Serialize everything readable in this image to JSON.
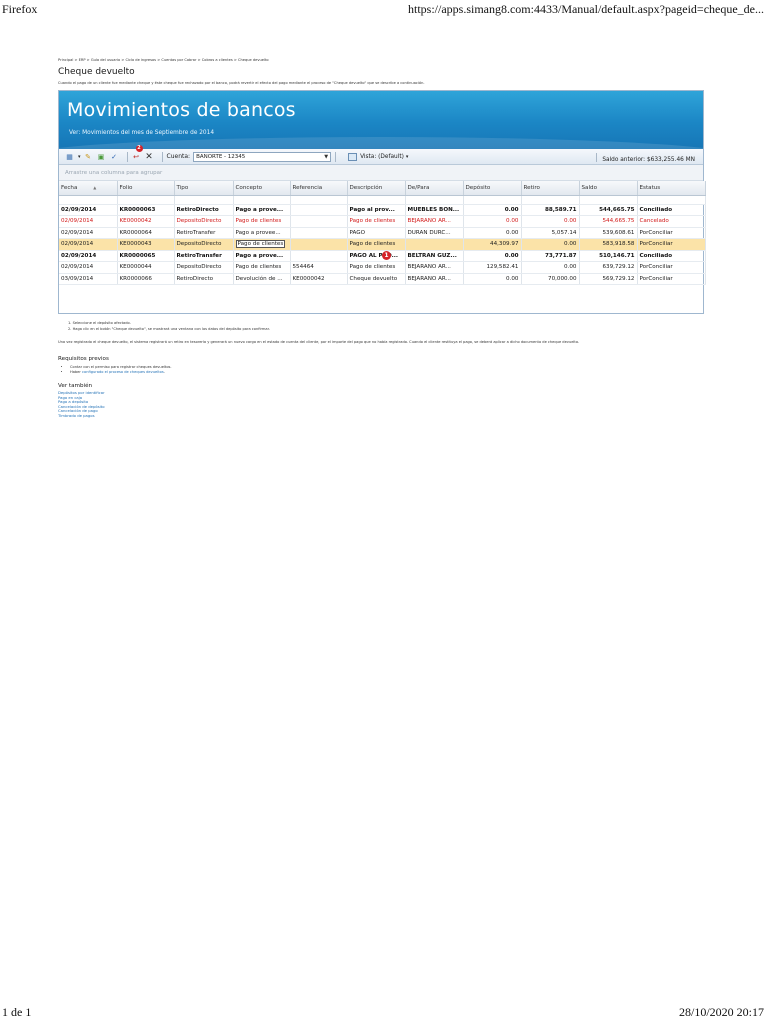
{
  "print_header": {
    "left": "Firefox",
    "right": "https://apps.simang8.com:4433/Manual/default.aspx?pageid=cheque_de..."
  },
  "print_footer": {
    "left": "1 de 1",
    "right": "28/10/2020 20:17"
  },
  "breadcrumb": "Principal > ERP > Guía del usuario > Ciclo de ingresos > Cuentas por Cobrar > Cobros a clientes > Cheque devuelto",
  "page_title": "Cheque devuelto",
  "intro": "Cuando el pago de un cliente fue mediante cheque y éste cheque fue rechazado por el banco, podrá revertir el efecto del pago mediante el proceso de \"Cheque devuelto\" que se describe a continuación.",
  "app": {
    "banner_title": "Movimientos de bancos",
    "banner_subtitle": "Ver: Movimientos del mes de Septiembre de 2014",
    "toolbar": {
      "cuenta_label": "Cuenta:",
      "cuenta_value": "BANORTE - 12345",
      "vista_label": "Vista: (Default)",
      "saldo_anterior": "Saldo anterior: $633,255.46 MN",
      "badge_number": "2"
    },
    "group_hint": "Arrastre una columna para agrupar",
    "columns": [
      "Fecha",
      "Folio",
      "Tipo",
      "Concepto",
      "Referencia",
      "Descripción",
      "De/Para",
      "Depósito",
      "Retiro",
      "Saldo",
      "Estatus"
    ],
    "rows": [
      {
        "style": "bold",
        "cells": [
          "02/09/2014",
          "KR0000063",
          "RetiroDirecto",
          "Pago a prove...",
          "",
          "Pago al prov...",
          "MUEBLES BON...",
          "0.00",
          "88,589.71",
          "544,665.75",
          "Conciliado"
        ]
      },
      {
        "style": "red",
        "cells": [
          "02/09/2014",
          "KE0000042",
          "DepositoDirecto",
          "Pago de clientes",
          "",
          "Pago de clientes",
          "BEJARANO AR...",
          "0.00",
          "0.00",
          "544,665.75",
          "Cancelado"
        ]
      },
      {
        "style": "",
        "cells": [
          "02/09/2014",
          "KR0000064",
          "RetiroTransfer",
          "Pago a provee...",
          "",
          "PAGO",
          "DURAN DURC...",
          "0.00",
          "5,057.14",
          "539,608.61",
          "PorConciliar"
        ]
      },
      {
        "style": "sel",
        "cells": [
          "02/09/2014",
          "KE0000043",
          "DepositoDirecto",
          "Pago de clientes",
          "",
          "Pago de clientes",
          "",
          "44,309.97",
          "0.00",
          "583,918.58",
          "PorConciliar"
        ]
      },
      {
        "style": "bold",
        "cells": [
          "02/09/2014",
          "KR0000065",
          "RetiroTransfer",
          "Pago a prove...",
          "",
          "PAGO AL PRO...",
          "BELTRAN GUZ...",
          "0.00",
          "73,771.87",
          "510,146.71",
          "Conciliado"
        ]
      },
      {
        "style": "",
        "cells": [
          "02/09/2014",
          "KE0000044",
          "DepositoDirecto",
          "Pago de clientes",
          "554464",
          "Pago de clientes",
          "BEJARANO AR...",
          "129,582.41",
          "0.00",
          "639,729.12",
          "PorConciliar"
        ]
      },
      {
        "style": "",
        "cells": [
          "03/09/2014",
          "KR0000066",
          "RetiroDirecto",
          "Devolución de ...",
          "KE0000042",
          "Cheque devuelto",
          "BEJARANO AR...",
          "0.00",
          "70,000.00",
          "569,729.12",
          "PorConciliar"
        ]
      }
    ],
    "marker_number": "1"
  },
  "steps": [
    "1. Seleccione el depósito afectado.",
    "2. Haga clic en el botón \"Cheque devuelto\", se mostrará una ventana con los datos del depósito para confirmar."
  ],
  "explanation": "Una vez registrado el cheque devuelto, el sistema registrará un retiro en tesorería y generará un nuevo cargo en el estado de cuenta del cliente, por el importe del pago que no había registrado. Cuando el cliente restituya el pago, se deberá aplicar a dicho documento de cheque devuelto.",
  "requisitos": {
    "title": "Requisitos previos",
    "items": [
      {
        "text": "Contar con el permiso para registrar cheques devueltos."
      },
      {
        "prefix": "Haber ",
        "link": "configurado el proceso de cheques devueltos",
        "suffix": "."
      }
    ]
  },
  "ver_tambien": {
    "title": "Ver también",
    "links": [
      "Depósitos por identificar",
      "Pago en caja",
      "Pago a depósito",
      "Cancelación de depósito",
      "Cancelación de pago",
      "Timbrado de pagos"
    ]
  },
  "colors": {
    "banner": "#1b86c5",
    "link": "#1f6fb5",
    "cancel_red": "#d11a1a",
    "selected_row": "#fbe3a8"
  }
}
